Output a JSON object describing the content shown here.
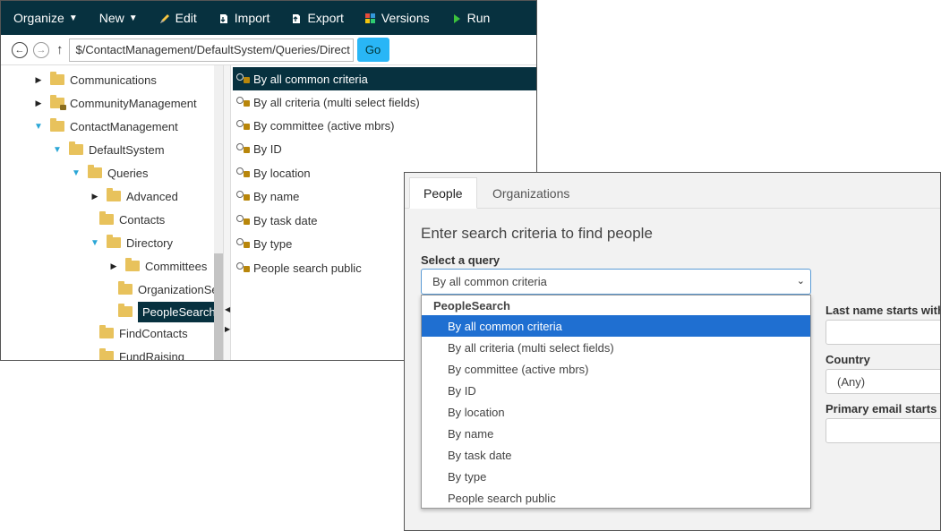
{
  "toolbar": {
    "organize": "Organize",
    "new": "New",
    "edit": "Edit",
    "import": "Import",
    "export": "Export",
    "versions": "Versions",
    "run": "Run"
  },
  "address": {
    "path": "$/ContactManagement/DefaultSystem/Queries/Direct",
    "go": "Go"
  },
  "tree": [
    {
      "label": "Communications",
      "state": "collapsed",
      "lock": false
    },
    {
      "label": "CommunityManagement",
      "state": "collapsed",
      "lock": true
    },
    {
      "label": "ContactManagement",
      "state": "expanded",
      "lock": false
    },
    {
      "label": "DefaultSystem",
      "state": "expanded",
      "lock": false
    },
    {
      "label": "Queries",
      "state": "expanded",
      "lock": false
    },
    {
      "label": "Advanced",
      "state": "collapsed",
      "lock": false
    },
    {
      "label": "Contacts",
      "state": "none",
      "lock": false
    },
    {
      "label": "Directory",
      "state": "expanded",
      "lock": false
    },
    {
      "label": "Committees",
      "state": "collapsed",
      "lock": false
    },
    {
      "label": "OrganizationSe",
      "state": "none",
      "lock": false
    },
    {
      "label": "PeopleSearch",
      "state": "none",
      "lock": false,
      "selected": true
    },
    {
      "label": "FindContacts",
      "state": "none",
      "lock": false
    },
    {
      "label": "FundRaising",
      "state": "none",
      "lock": false
    }
  ],
  "queries": [
    "By all common criteria",
    "By all criteria (multi select fields)",
    "By committee (active mbrs)",
    "By ID",
    "By location",
    "By name",
    "By task date",
    "By type",
    "People search public"
  ],
  "dialog": {
    "tabs": [
      "People",
      "Organizations"
    ],
    "heading": "Enter search criteria to find people",
    "select_label": "Select a query",
    "selected_query": "By all common criteria",
    "group_label": "PeopleSearch",
    "options": [
      "By all common criteria",
      "By all criteria (multi select fields)",
      "By committee (active mbrs)",
      "By ID",
      "By location",
      "By name",
      "By task date",
      "By type",
      "People search public"
    ],
    "fields": {
      "last_name_label": "Last name starts with",
      "country_label": "Country",
      "country_value": "(Any)",
      "email_label": "Primary email starts with"
    }
  },
  "colors": {
    "toolbar_bg": "#07313f",
    "accent": "#29b6f6",
    "highlight": "#1f6fd1",
    "folder": "#e8c25c"
  }
}
